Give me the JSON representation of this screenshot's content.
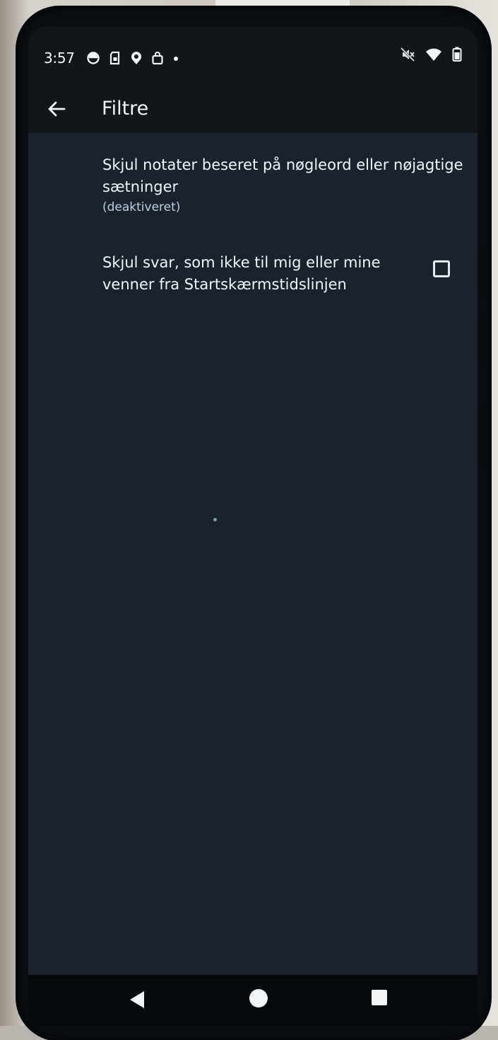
{
  "status_bar": {
    "time": "3:57",
    "left_icons": [
      "notification-icon",
      "sim-card-icon",
      "map-pin-icon",
      "shopping-bag-icon",
      "dot-icon"
    ],
    "right_icons": [
      "mute-icon",
      "wifi-icon",
      "battery-icon"
    ]
  },
  "app_bar": {
    "title": "Filtre",
    "back_icon": "arrow-left-icon"
  },
  "preferences": [
    {
      "title": "Skjul notater beseret på nøgleord eller nøjagtige sætninger",
      "summary": "(deaktiveret)"
    },
    {
      "title": "Skjul svar, som ikke til mig eller mine venner fra Startskærmstidslinjen",
      "checked": false
    }
  ],
  "nav_bar": {
    "buttons": [
      "back-triangle-icon",
      "home-circle-icon",
      "recents-square-icon"
    ]
  }
}
